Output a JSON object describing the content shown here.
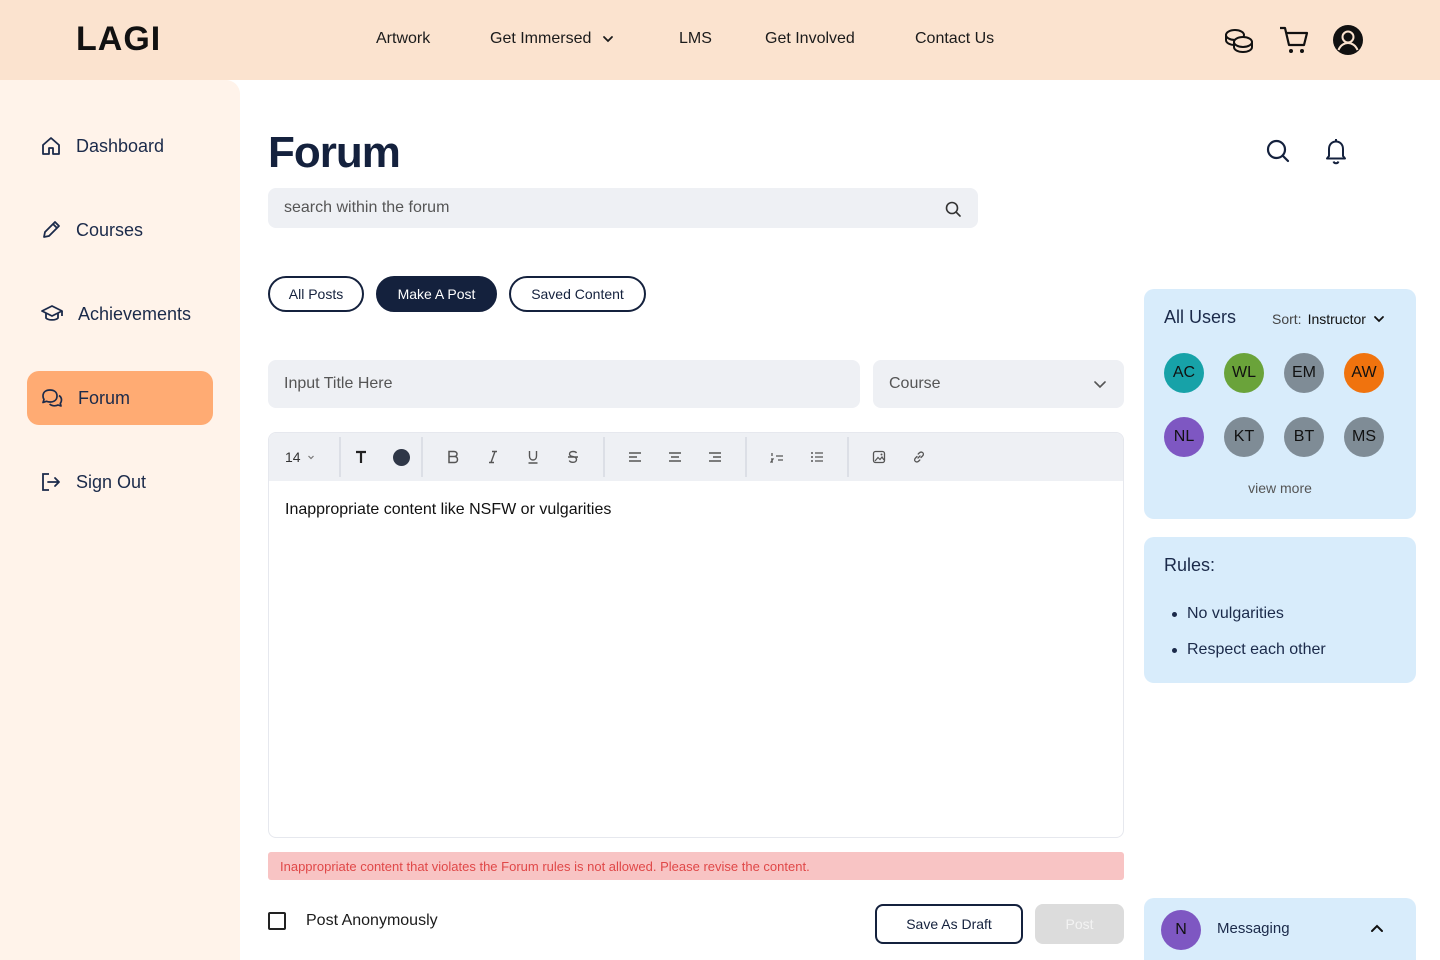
{
  "header": {
    "logo": "LAGI",
    "nav": [
      {
        "label": "Artwork"
      },
      {
        "label": "Get Immersed",
        "has_dropdown": true
      },
      {
        "label": "LMS"
      },
      {
        "label": "Get Involved"
      },
      {
        "label": "Contact Us"
      }
    ],
    "icons": [
      "coins-icon",
      "cart-icon",
      "account-icon"
    ]
  },
  "sidebar": {
    "items": [
      {
        "label": "Dashboard",
        "icon": "home-icon",
        "active": false
      },
      {
        "label": "Courses",
        "icon": "pencil-icon",
        "active": false
      },
      {
        "label": "Achievements",
        "icon": "graduation-cap-icon",
        "active": false
      },
      {
        "label": "Forum",
        "icon": "chat-icon",
        "active": true
      },
      {
        "label": "Sign Out",
        "icon": "sign-out-icon",
        "active": false
      }
    ]
  },
  "main": {
    "title": "Forum",
    "search_placeholder": "search within the forum",
    "tabs": [
      {
        "label": "All Posts",
        "active": false
      },
      {
        "label": "Make A Post",
        "active": true
      },
      {
        "label": "Saved Content",
        "active": false
      }
    ],
    "title_placeholder": "Input Title Here",
    "course_select": "Course",
    "toolbar": {
      "font_size": "14",
      "text_color": "#2f3747"
    },
    "editor_content": "Inappropriate content like NSFW or vulgarities",
    "error_message": "Inappropriate content that violates the Forum rules is not allowed. Please revise the content.",
    "post_anonymously_label": "Post Anonymously",
    "save_draft_label": "Save As Draft",
    "post_label": "Post"
  },
  "users_panel": {
    "title": "All Users",
    "sort_label": "Sort:",
    "sort_value": "Instructor",
    "users": [
      {
        "initials": "AC",
        "color": "#17a2a8"
      },
      {
        "initials": "WL",
        "color": "#6aa33a"
      },
      {
        "initials": "EM",
        "color": "#7f8c96"
      },
      {
        "initials": "AW",
        "color": "#f0730e"
      },
      {
        "initials": "NL",
        "color": "#7e57c2"
      },
      {
        "initials": "KT",
        "color": "#7f8c96"
      },
      {
        "initials": "BT",
        "color": "#7f8c96"
      },
      {
        "initials": "MS",
        "color": "#7f8c96"
      }
    ],
    "view_more": "view more"
  },
  "rules_panel": {
    "title": "Rules:",
    "rules": [
      "No vulgarities",
      "Respect each other"
    ]
  },
  "messaging": {
    "avatar": "N",
    "label": "Messaging"
  },
  "colors": {
    "header_bg": "#fbe3cf",
    "sidebar_bg": "#fff3ea",
    "sidebar_active": "#ffab73",
    "navy": "#14213d",
    "panel_bg": "#d8ecfb",
    "error_bg": "#f8c4c4",
    "error_text": "#e04848"
  }
}
